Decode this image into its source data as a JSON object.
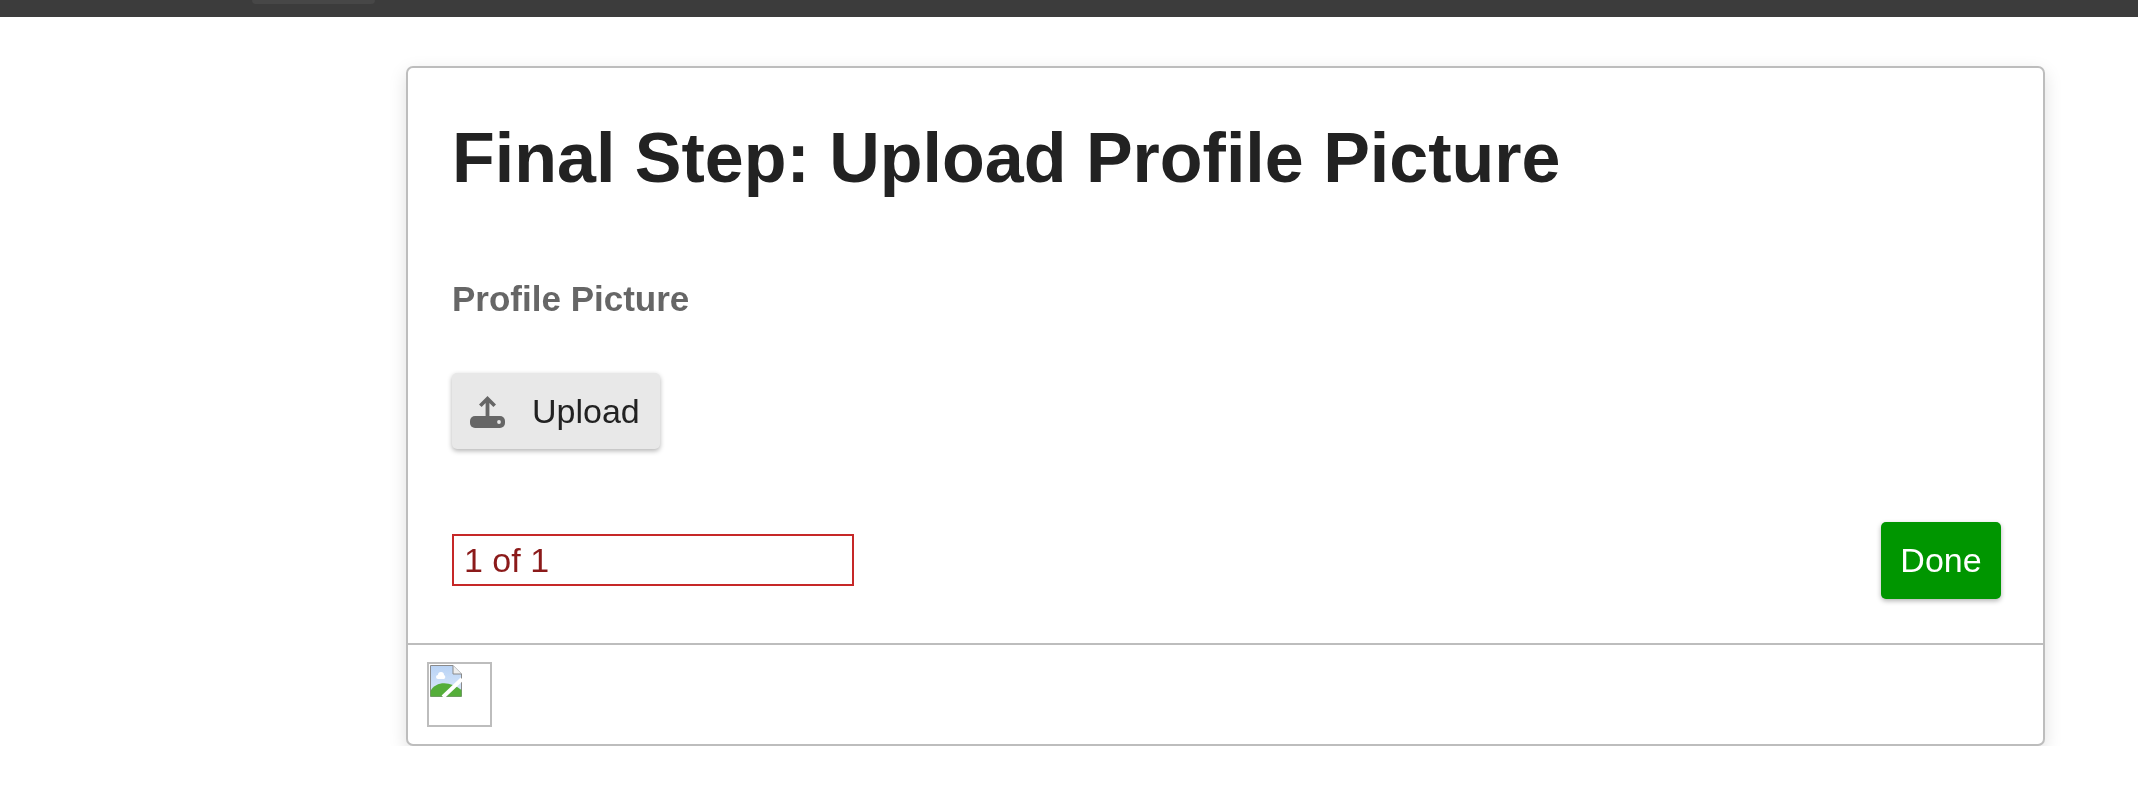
{
  "card": {
    "title": "Final Step: Upload Profile Picture",
    "field_label": "Profile Picture",
    "upload_button": {
      "label": "Upload"
    },
    "step_field": {
      "value": "1 of 1"
    },
    "done_button": {
      "label": "Done"
    }
  }
}
